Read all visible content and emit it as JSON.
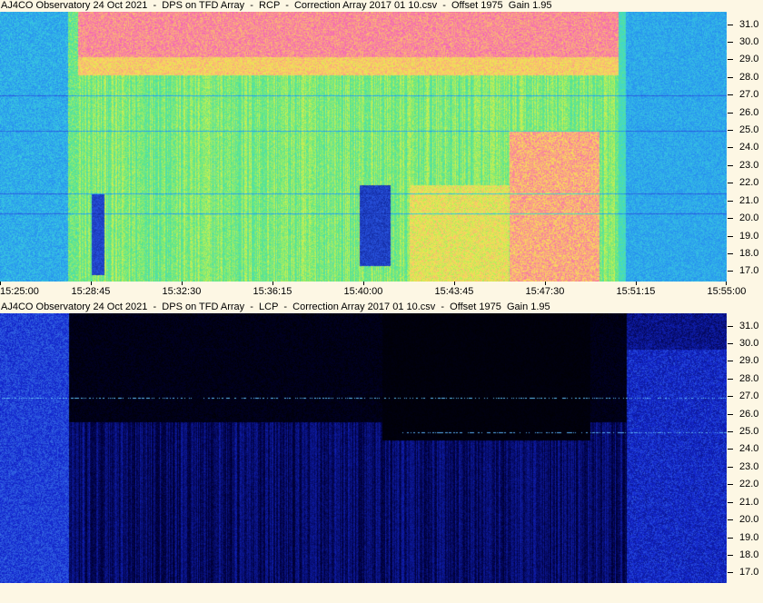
{
  "panels": [
    {
      "title": "AJ4CO Observatory 24 Oct 2021  -  DPS on TFD Array  -  RCP  -  Correction Array 2017 01 10.csv  -  Offset 1975  Gain 1.95",
      "palette": "rainbow"
    },
    {
      "title": "AJ4CO Observatory 24 Oct 2021  -  DPS on TFD Array  -  LCP  -  Correction Array 2017 01 10.csv  -  Offset 1975  Gain 1.95",
      "palette": "blue"
    }
  ],
  "xaxis_ticks": [
    "15:25:00",
    "15:28:45",
    "15:32:30",
    "15:36:15",
    "15:40:00",
    "15:43:45",
    "15:47:30",
    "15:51:15",
    "15:55:00"
  ],
  "chart_data": {
    "type": "heatmap",
    "title": "AJ4CO Observatory 24 Oct 2021 - DPS on TFD Array",
    "xlabel": "",
    "ylabel": "",
    "x_range": [
      "15:25:00",
      "15:55:00"
    ],
    "y_range_mhz": [
      16.4,
      31.7
    ],
    "y_ticks": [
      31.0,
      30.0,
      29.0,
      28.0,
      27.0,
      26.0,
      25.0,
      24.0,
      23.0,
      22.0,
      21.0,
      20.0,
      19.0,
      18.0,
      17.0
    ],
    "x_ticks": [
      "15:25:00",
      "15:28:45",
      "15:32:30",
      "15:36:15",
      "15:40:00",
      "15:43:45",
      "15:47:30",
      "15:51:15",
      "15:55:00"
    ],
    "series": [
      {
        "name": "RCP",
        "description_level": "strong emission 15:28:45 to ~15:50"
      },
      {
        "name": "LCP",
        "description_level": "weak / dark"
      }
    ]
  }
}
